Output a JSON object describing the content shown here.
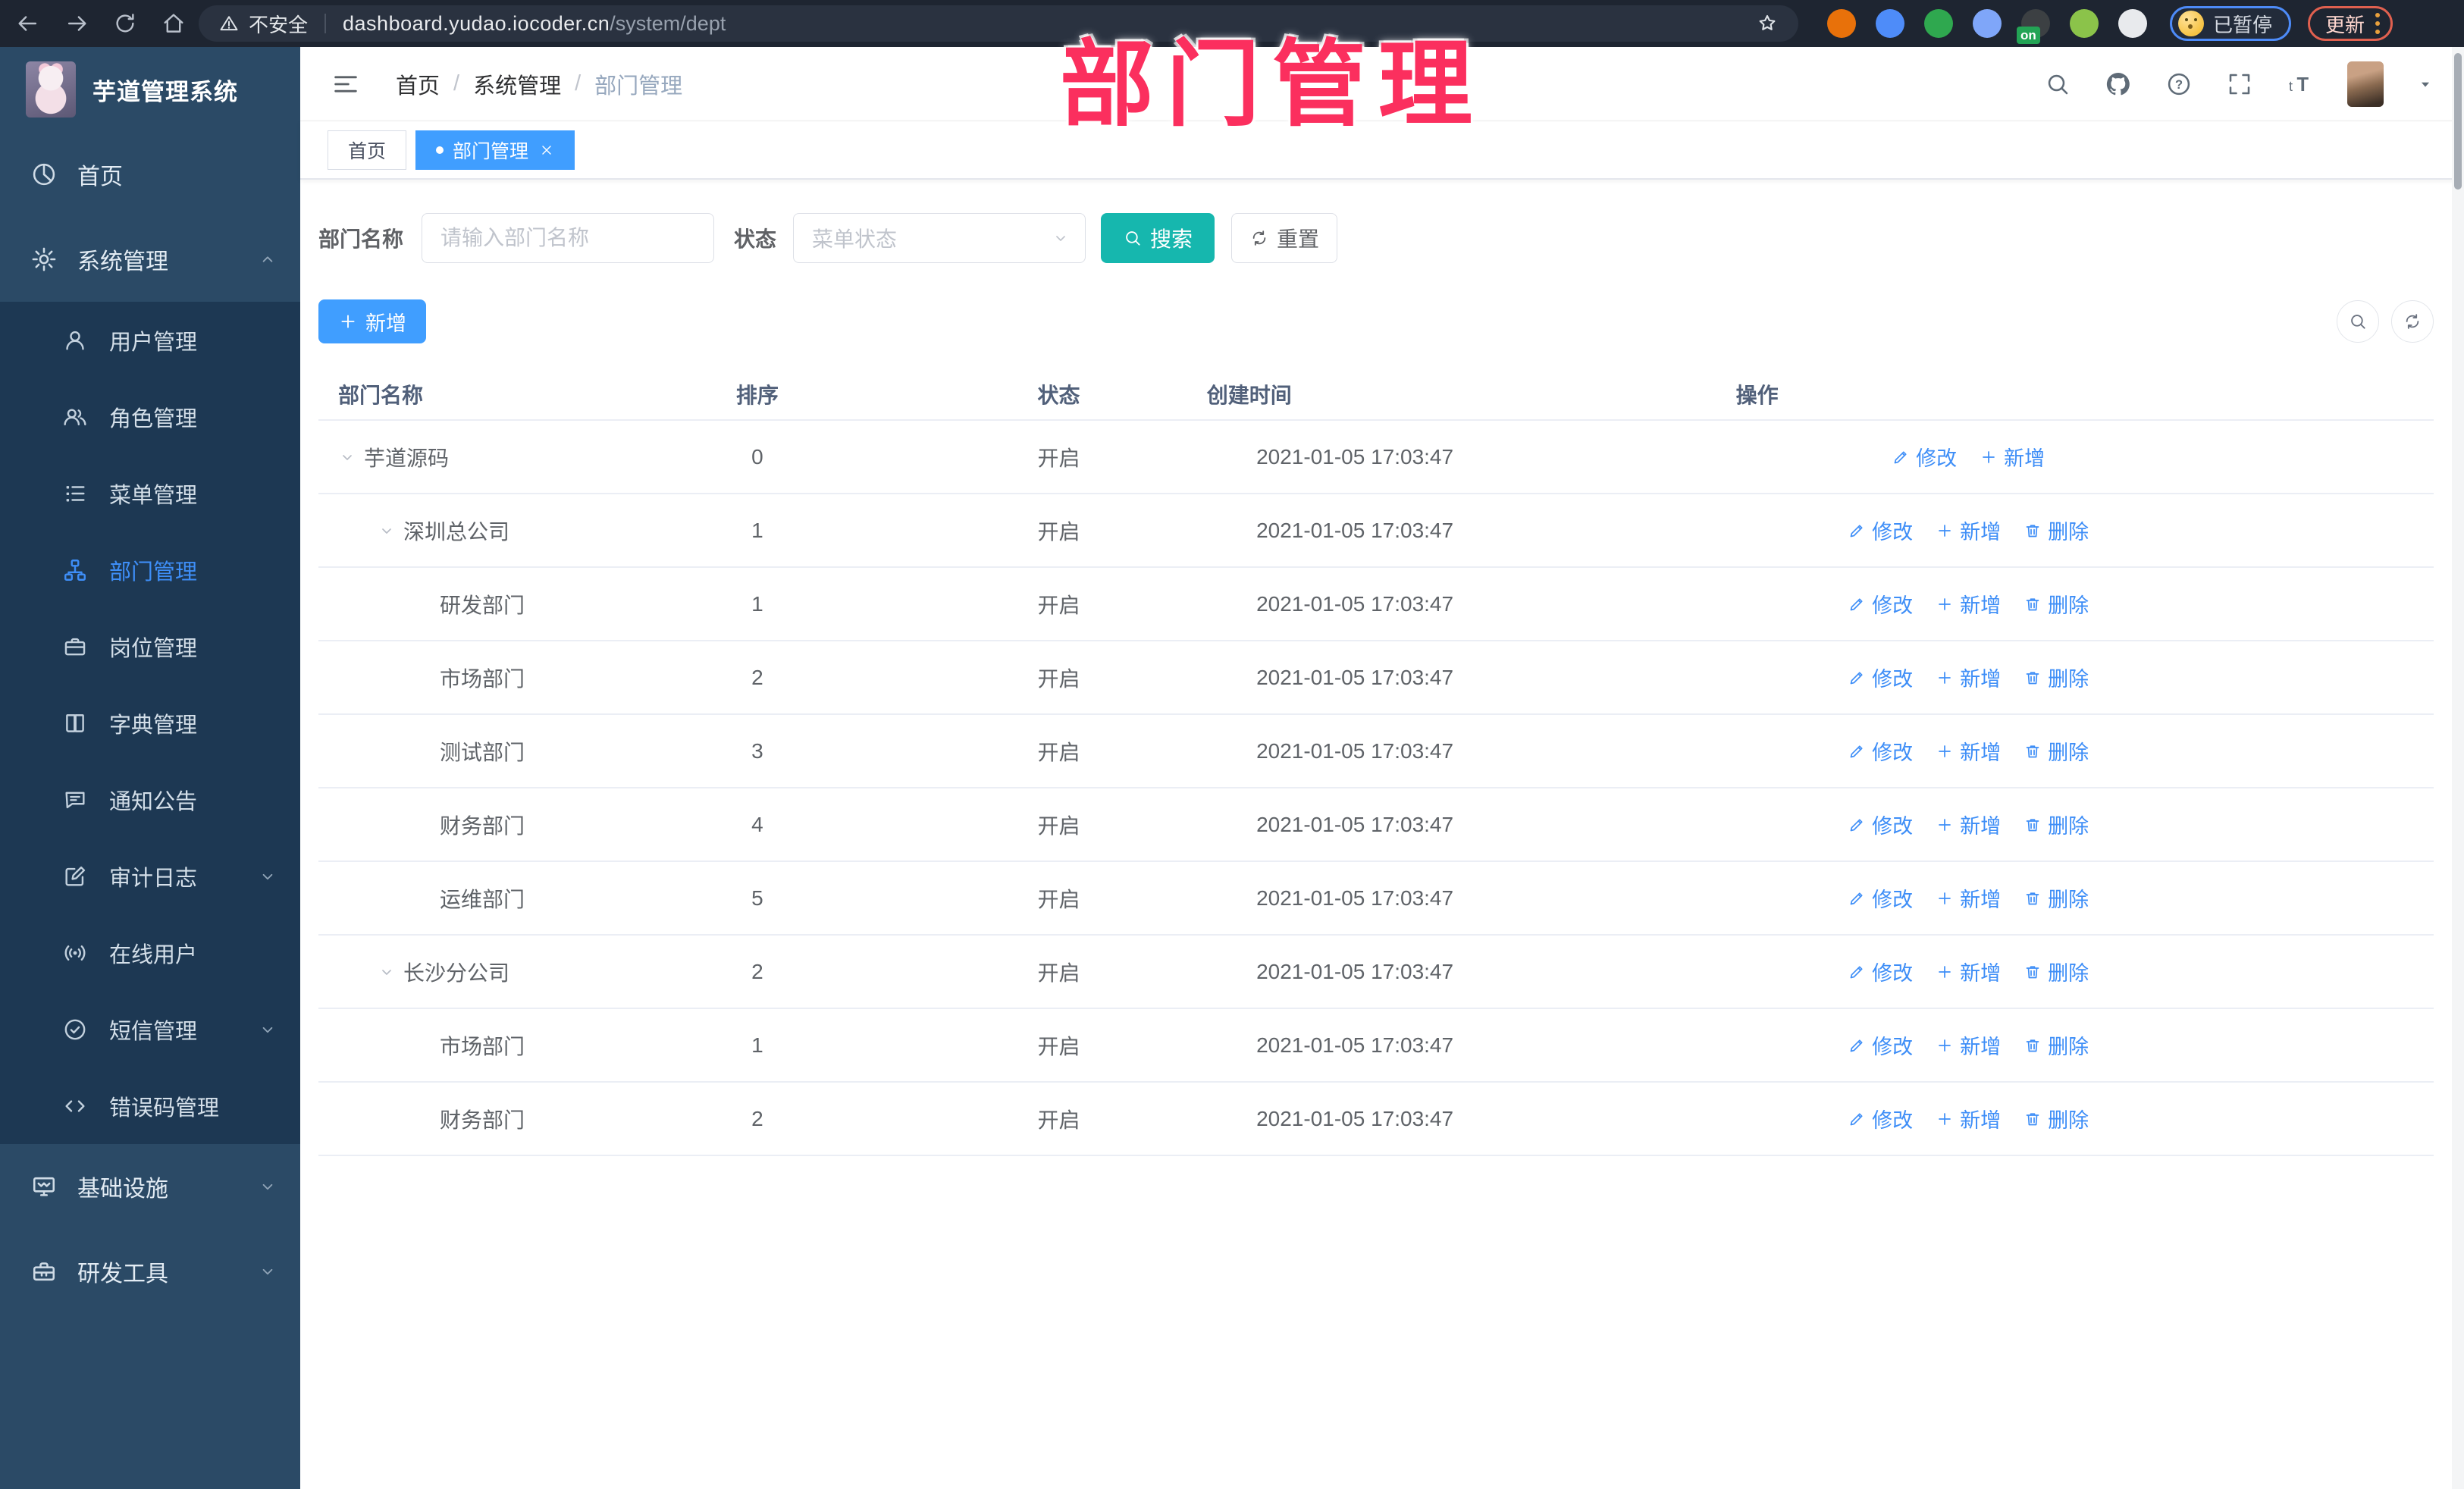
{
  "colors": {
    "accent_blue": "#409eff",
    "teal_search": "#16b7ae",
    "annotation_pink": "#fb2f5e",
    "sidebar_bg": "#2b4a66",
    "submenu_bg": "#1d3853"
  },
  "browser": {
    "security_label": "不安全",
    "url_host": "dashboard.yudao.iocoder.cn",
    "url_path": "/system/dept",
    "profile_label": "已暂停",
    "update_label": "更新",
    "extensions": [
      {
        "id": "orange-ring-extension",
        "color": "#e8710a"
      },
      {
        "id": "blue-gem-extension",
        "color": "#4e8cf9"
      },
      {
        "id": "green-check-extension",
        "color": "#2fa84f"
      },
      {
        "id": "blue-grid-extension",
        "color": "#7fa6f9"
      },
      {
        "id": "dark-lines-extension",
        "color": "#3c4043",
        "badge": "on",
        "badge_color": "#23a455"
      },
      {
        "id": "green-figure-extension",
        "color": "#8bc34a"
      },
      {
        "id": "white-figure-extension",
        "color": "#e8eaed"
      }
    ]
  },
  "sidebar": {
    "title": "芋道管理系统",
    "items": [
      {
        "id": "home",
        "label": "首页",
        "icon": "dashboard-icon"
      },
      {
        "id": "system-management",
        "label": "系统管理",
        "icon": "gear-icon",
        "expanded": true,
        "children": [
          {
            "id": "user-management",
            "label": "用户管理",
            "icon": "user-icon"
          },
          {
            "id": "role-management",
            "label": "角色管理",
            "icon": "users-icon"
          },
          {
            "id": "menu-management",
            "label": "菜单管理",
            "icon": "menu-list-icon"
          },
          {
            "id": "dept-management",
            "label": "部门管理",
            "icon": "org-tree-icon",
            "active": true
          },
          {
            "id": "post-management",
            "label": "岗位管理",
            "icon": "briefcase-icon"
          },
          {
            "id": "dict-management",
            "label": "字典管理",
            "icon": "book-icon"
          },
          {
            "id": "notice-announcement",
            "label": "通知公告",
            "icon": "chat-bubble-icon"
          },
          {
            "id": "audit-log",
            "label": "审计日志",
            "icon": "edit-icon",
            "collapsible": true
          },
          {
            "id": "online-users",
            "label": "在线用户",
            "icon": "broadcast-icon"
          },
          {
            "id": "sms-management",
            "label": "短信管理",
            "icon": "check-circle-icon",
            "collapsible": true
          },
          {
            "id": "error-code-management",
            "label": "错误码管理",
            "icon": "code-icon"
          }
        ]
      },
      {
        "id": "infrastructure",
        "label": "基础设施",
        "icon": "monitor-icon",
        "collapsible": true
      },
      {
        "id": "dev-tools",
        "label": "研发工具",
        "icon": "toolbox-icon",
        "collapsible": true
      }
    ]
  },
  "header": {
    "breadcrumb": [
      "首页",
      "系统管理",
      "部门管理"
    ],
    "actions": [
      {
        "id": "search"
      },
      {
        "id": "github"
      },
      {
        "id": "help"
      },
      {
        "id": "fullscreen"
      },
      {
        "id": "font-size"
      }
    ]
  },
  "tabs": [
    {
      "id": "home",
      "label": "首页",
      "active": false,
      "closable": false
    },
    {
      "id": "dept-management",
      "label": "部门管理",
      "active": true,
      "closable": true
    }
  ],
  "filters": {
    "name_label": "部门名称",
    "name_placeholder": "请输入部门名称",
    "name_value": "",
    "status_label": "状态",
    "status_placeholder": "菜单状态",
    "search_label": "搜索",
    "reset_label": "重置"
  },
  "toolbar": {
    "add_label": "新增"
  },
  "table": {
    "columns": [
      {
        "id": "name",
        "label": "部门名称"
      },
      {
        "id": "sort",
        "label": "排序"
      },
      {
        "id": "status",
        "label": "状态"
      },
      {
        "id": "created",
        "label": "创建时间"
      },
      {
        "id": "ops",
        "label": "操作"
      }
    ],
    "action_labels": {
      "modify": "修改",
      "add": "新增",
      "delete": "删除"
    },
    "rows": [
      {
        "name": "芋道源码",
        "level": 0,
        "expandable": true,
        "sort": "0",
        "status": "开启",
        "created": "2021-01-05 17:03:47",
        "actions": [
          "modify",
          "add"
        ]
      },
      {
        "name": "深圳总公司",
        "level": 1,
        "expandable": true,
        "sort": "1",
        "status": "开启",
        "created": "2021-01-05 17:03:47",
        "actions": [
          "modify",
          "add",
          "delete"
        ]
      },
      {
        "name": "研发部门",
        "level": 2,
        "expandable": false,
        "sort": "1",
        "status": "开启",
        "created": "2021-01-05 17:03:47",
        "actions": [
          "modify",
          "add",
          "delete"
        ]
      },
      {
        "name": "市场部门",
        "level": 2,
        "expandable": false,
        "sort": "2",
        "status": "开启",
        "created": "2021-01-05 17:03:47",
        "actions": [
          "modify",
          "add",
          "delete"
        ]
      },
      {
        "name": "测试部门",
        "level": 2,
        "expandable": false,
        "sort": "3",
        "status": "开启",
        "created": "2021-01-05 17:03:47",
        "actions": [
          "modify",
          "add",
          "delete"
        ]
      },
      {
        "name": "财务部门",
        "level": 2,
        "expandable": false,
        "sort": "4",
        "status": "开启",
        "created": "2021-01-05 17:03:47",
        "actions": [
          "modify",
          "add",
          "delete"
        ]
      },
      {
        "name": "运维部门",
        "level": 2,
        "expandable": false,
        "sort": "5",
        "status": "开启",
        "created": "2021-01-05 17:03:47",
        "actions": [
          "modify",
          "add",
          "delete"
        ]
      },
      {
        "name": "长沙分公司",
        "level": 1,
        "expandable": true,
        "sort": "2",
        "status": "开启",
        "created": "2021-01-05 17:03:47",
        "actions": [
          "modify",
          "add",
          "delete"
        ]
      },
      {
        "name": "市场部门",
        "level": 2,
        "expandable": false,
        "sort": "1",
        "status": "开启",
        "created": "2021-01-05 17:03:47",
        "actions": [
          "modify",
          "add",
          "delete"
        ]
      },
      {
        "name": "财务部门",
        "level": 2,
        "expandable": false,
        "sort": "2",
        "status": "开启",
        "created": "2021-01-05 17:03:47",
        "actions": [
          "modify",
          "add",
          "delete"
        ]
      }
    ]
  },
  "annotation": {
    "text": "部门管理"
  }
}
